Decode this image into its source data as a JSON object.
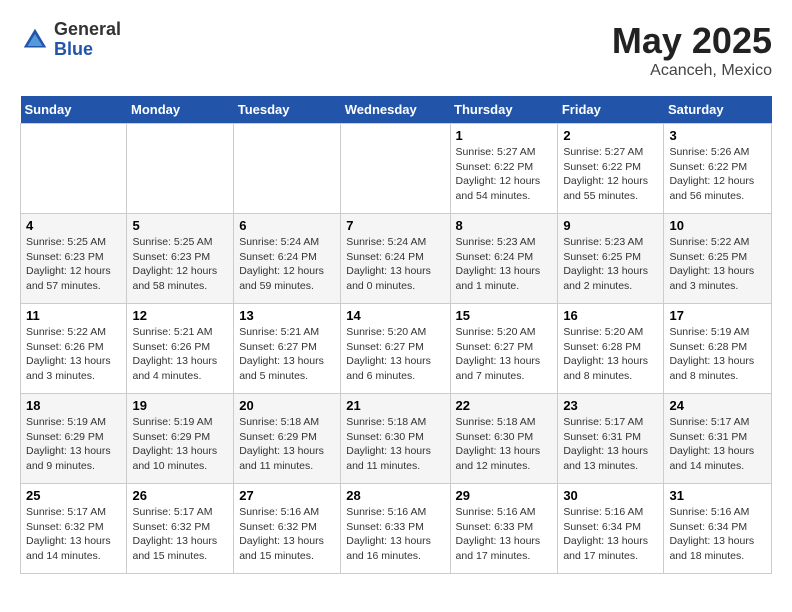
{
  "logo": {
    "general": "General",
    "blue": "Blue"
  },
  "title": "May 2025",
  "subtitle": "Acanceh, Mexico",
  "days_of_week": [
    "Sunday",
    "Monday",
    "Tuesday",
    "Wednesday",
    "Thursday",
    "Friday",
    "Saturday"
  ],
  "weeks": [
    [
      {
        "day": "",
        "detail": ""
      },
      {
        "day": "",
        "detail": ""
      },
      {
        "day": "",
        "detail": ""
      },
      {
        "day": "",
        "detail": ""
      },
      {
        "day": "1",
        "detail": "Sunrise: 5:27 AM\nSunset: 6:22 PM\nDaylight: 12 hours\nand 54 minutes."
      },
      {
        "day": "2",
        "detail": "Sunrise: 5:27 AM\nSunset: 6:22 PM\nDaylight: 12 hours\nand 55 minutes."
      },
      {
        "day": "3",
        "detail": "Sunrise: 5:26 AM\nSunset: 6:22 PM\nDaylight: 12 hours\nand 56 minutes."
      }
    ],
    [
      {
        "day": "4",
        "detail": "Sunrise: 5:25 AM\nSunset: 6:23 PM\nDaylight: 12 hours\nand 57 minutes."
      },
      {
        "day": "5",
        "detail": "Sunrise: 5:25 AM\nSunset: 6:23 PM\nDaylight: 12 hours\nand 58 minutes."
      },
      {
        "day": "6",
        "detail": "Sunrise: 5:24 AM\nSunset: 6:24 PM\nDaylight: 12 hours\nand 59 minutes."
      },
      {
        "day": "7",
        "detail": "Sunrise: 5:24 AM\nSunset: 6:24 PM\nDaylight: 13 hours\nand 0 minutes."
      },
      {
        "day": "8",
        "detail": "Sunrise: 5:23 AM\nSunset: 6:24 PM\nDaylight: 13 hours\nand 1 minute."
      },
      {
        "day": "9",
        "detail": "Sunrise: 5:23 AM\nSunset: 6:25 PM\nDaylight: 13 hours\nand 2 minutes."
      },
      {
        "day": "10",
        "detail": "Sunrise: 5:22 AM\nSunset: 6:25 PM\nDaylight: 13 hours\nand 3 minutes."
      }
    ],
    [
      {
        "day": "11",
        "detail": "Sunrise: 5:22 AM\nSunset: 6:26 PM\nDaylight: 13 hours\nand 3 minutes."
      },
      {
        "day": "12",
        "detail": "Sunrise: 5:21 AM\nSunset: 6:26 PM\nDaylight: 13 hours\nand 4 minutes."
      },
      {
        "day": "13",
        "detail": "Sunrise: 5:21 AM\nSunset: 6:27 PM\nDaylight: 13 hours\nand 5 minutes."
      },
      {
        "day": "14",
        "detail": "Sunrise: 5:20 AM\nSunset: 6:27 PM\nDaylight: 13 hours\nand 6 minutes."
      },
      {
        "day": "15",
        "detail": "Sunrise: 5:20 AM\nSunset: 6:27 PM\nDaylight: 13 hours\nand 7 minutes."
      },
      {
        "day": "16",
        "detail": "Sunrise: 5:20 AM\nSunset: 6:28 PM\nDaylight: 13 hours\nand 8 minutes."
      },
      {
        "day": "17",
        "detail": "Sunrise: 5:19 AM\nSunset: 6:28 PM\nDaylight: 13 hours\nand 8 minutes."
      }
    ],
    [
      {
        "day": "18",
        "detail": "Sunrise: 5:19 AM\nSunset: 6:29 PM\nDaylight: 13 hours\nand 9 minutes."
      },
      {
        "day": "19",
        "detail": "Sunrise: 5:19 AM\nSunset: 6:29 PM\nDaylight: 13 hours\nand 10 minutes."
      },
      {
        "day": "20",
        "detail": "Sunrise: 5:18 AM\nSunset: 6:29 PM\nDaylight: 13 hours\nand 11 minutes."
      },
      {
        "day": "21",
        "detail": "Sunrise: 5:18 AM\nSunset: 6:30 PM\nDaylight: 13 hours\nand 11 minutes."
      },
      {
        "day": "22",
        "detail": "Sunrise: 5:18 AM\nSunset: 6:30 PM\nDaylight: 13 hours\nand 12 minutes."
      },
      {
        "day": "23",
        "detail": "Sunrise: 5:17 AM\nSunset: 6:31 PM\nDaylight: 13 hours\nand 13 minutes."
      },
      {
        "day": "24",
        "detail": "Sunrise: 5:17 AM\nSunset: 6:31 PM\nDaylight: 13 hours\nand 14 minutes."
      }
    ],
    [
      {
        "day": "25",
        "detail": "Sunrise: 5:17 AM\nSunset: 6:32 PM\nDaylight: 13 hours\nand 14 minutes."
      },
      {
        "day": "26",
        "detail": "Sunrise: 5:17 AM\nSunset: 6:32 PM\nDaylight: 13 hours\nand 15 minutes."
      },
      {
        "day": "27",
        "detail": "Sunrise: 5:16 AM\nSunset: 6:32 PM\nDaylight: 13 hours\nand 15 minutes."
      },
      {
        "day": "28",
        "detail": "Sunrise: 5:16 AM\nSunset: 6:33 PM\nDaylight: 13 hours\nand 16 minutes."
      },
      {
        "day": "29",
        "detail": "Sunrise: 5:16 AM\nSunset: 6:33 PM\nDaylight: 13 hours\nand 17 minutes."
      },
      {
        "day": "30",
        "detail": "Sunrise: 5:16 AM\nSunset: 6:34 PM\nDaylight: 13 hours\nand 17 minutes."
      },
      {
        "day": "31",
        "detail": "Sunrise: 5:16 AM\nSunset: 6:34 PM\nDaylight: 13 hours\nand 18 minutes."
      }
    ]
  ]
}
